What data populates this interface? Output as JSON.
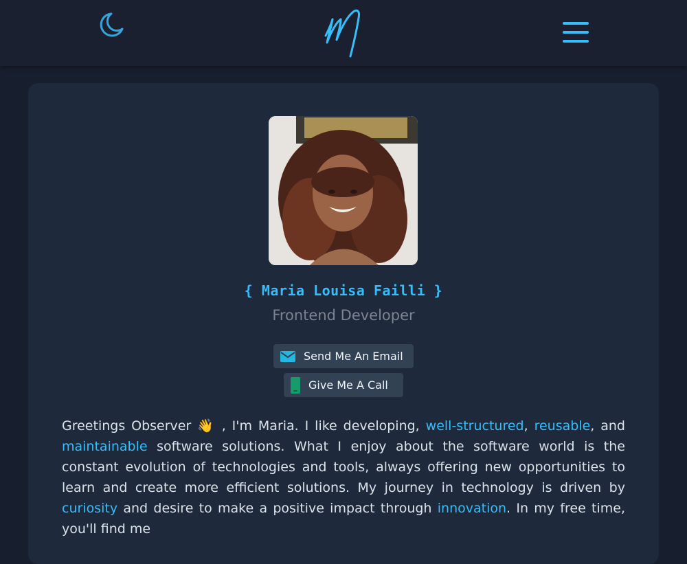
{
  "header": {
    "theme_toggle_icon": "moon-icon",
    "logo_icon": "m-signature-logo",
    "menu_icon": "hamburger-menu-icon",
    "accent_color": "#38bdf8"
  },
  "profile": {
    "photo_icon": "profile-photo",
    "name": "{ Maria Louisa Failli }",
    "role": "Frontend Developer"
  },
  "actions": {
    "email_label": "Send Me An Email",
    "email_icon": "envelope-icon",
    "call_label": "Give Me A Call",
    "call_icon": "phone-icon"
  },
  "bio": {
    "p1": "Greetings Observer",
    "wave": "👋",
    "p2": ", I'm Maria. I like developing,",
    "h1": "well-structured",
    "p3": ",",
    "h2": "reusable",
    "p4": ", and",
    "h3": "maintainable",
    "p5": "software solutions. What I enjoy about the software world is the constant evolution of technologies and tools, always offering new opportunities to learn and create more efficient solutions. My journey in technology is driven by",
    "h4": "curiosity",
    "p6": "and desire to make a positive impact through",
    "h5": "innovation",
    "p7": ". In my free time, you'll find me"
  }
}
